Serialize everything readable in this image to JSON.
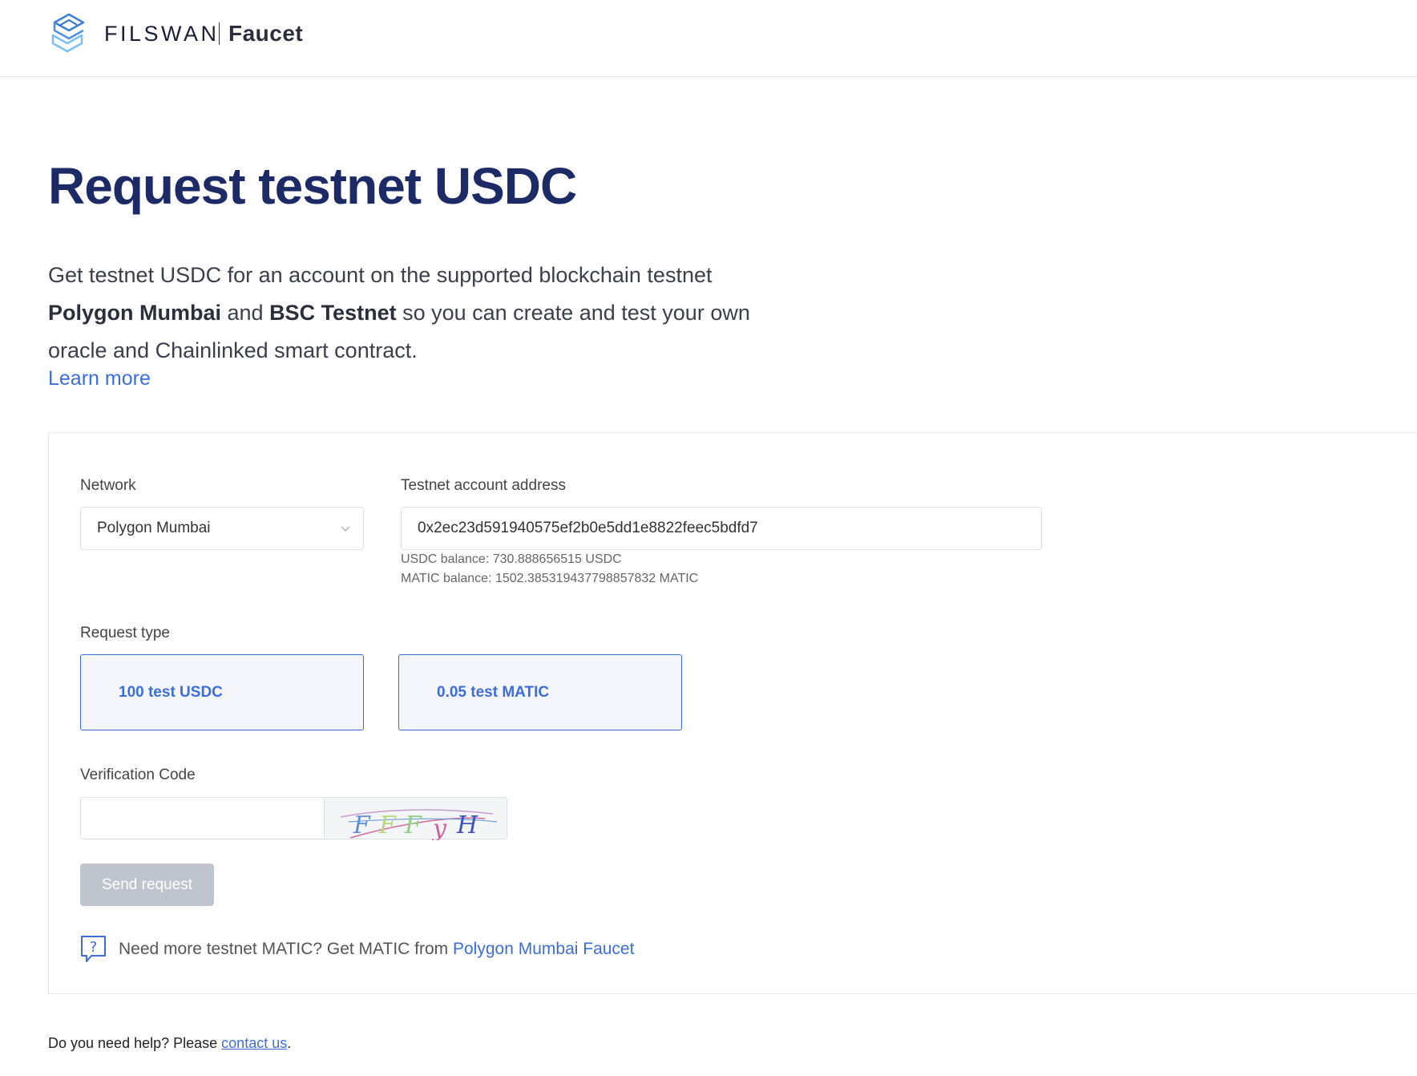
{
  "header": {
    "brand": "FILSWAN",
    "product": "Faucet"
  },
  "hero": {
    "title": "Request testnet USDC",
    "desc_part1": "Get testnet USDC for an account on the supported blockchain testnet ",
    "network1": "Polygon Mumbai",
    "desc_and": " and ",
    "network2": "BSC Testnet",
    "desc_part2": " so you can create and test your own oracle and Chainlinked smart contract.",
    "learn_more": "Learn more"
  },
  "form": {
    "network_label": "Network",
    "network_value": "Polygon Mumbai",
    "address_label": "Testnet account address",
    "address_value": "0x2ec23d591940575ef2b0e5dd1e8822feec5bdfd7",
    "usdc_balance": "USDC balance: 730.888656515 USDC",
    "matic_balance": "MATIC balance: 1502.385319437798857832 MATIC",
    "request_type_label": "Request type",
    "request_types": [
      "100 test USDC",
      "0.05 test MATIC"
    ],
    "verification_label": "Verification Code",
    "verification_value": "",
    "captcha_text": "FFFyH",
    "send_label": "Send request",
    "need_more_text": "Need more testnet MATIC? Get MATIC from ",
    "need_more_link": "Polygon Mumbai Faucet"
  },
  "footer": {
    "text": "Do you need help? Please ",
    "link": "contact us",
    "end": "."
  },
  "colors": {
    "title": "#1c2b66",
    "accent": "#3c6ed6",
    "disabled_button": "#c0c4cc"
  },
  "icons": [
    "filswan-logo-icon",
    "chevron-down-icon",
    "help-question-icon"
  ]
}
